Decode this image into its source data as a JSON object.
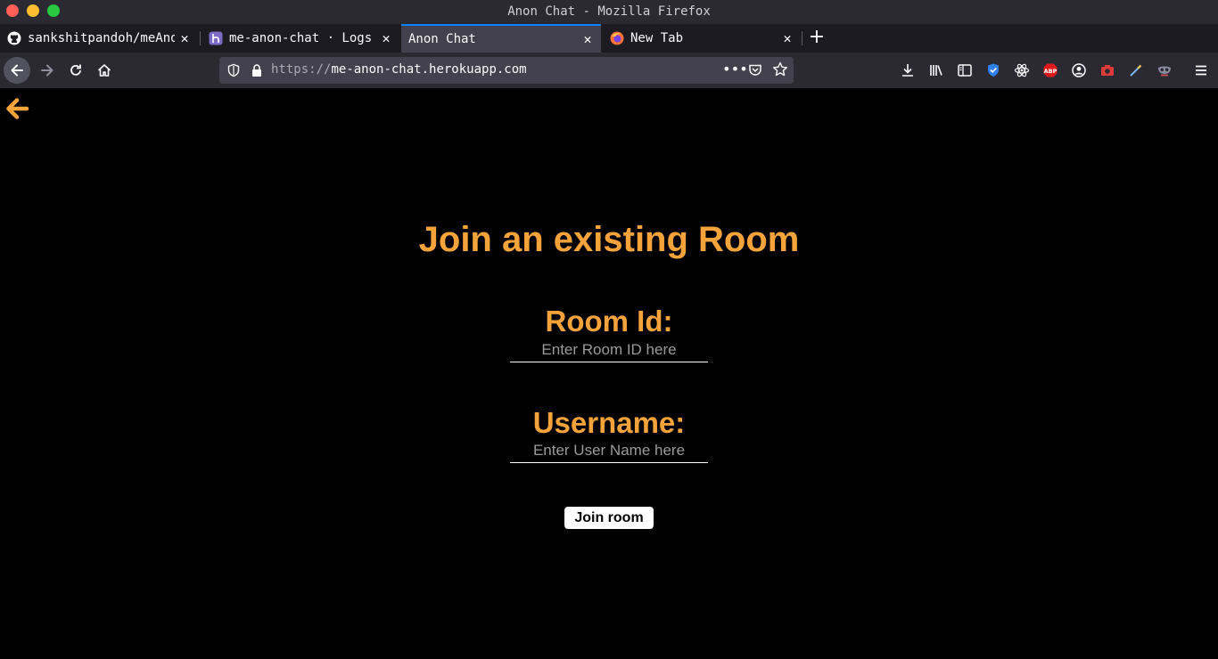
{
  "window": {
    "title": "Anon Chat - Mozilla Firefox"
  },
  "tabs": [
    {
      "label": "sankshitpandoh/meAnonC",
      "icon": "github-icon"
    },
    {
      "label": "me-anon-chat · Logs",
      "icon": "heroku-icon"
    },
    {
      "label": "Anon Chat",
      "icon": "none",
      "active": true
    },
    {
      "label": "New Tab",
      "icon": "firefox-icon"
    }
  ],
  "navbar": {
    "url_protocol": "https://",
    "url_host": "me-anon-chat.herokuapp.com"
  },
  "page": {
    "heading": "Join an existing Room",
    "room_label": "Room Id:",
    "room_placeholder": "Enter Room ID here",
    "username_label": "Username:",
    "username_placeholder": "Enter User Name here",
    "join_button": "Join room"
  },
  "colors": {
    "accent": "#f5a33a",
    "background": "#000000",
    "active_tab_line": "#0a84ff"
  }
}
